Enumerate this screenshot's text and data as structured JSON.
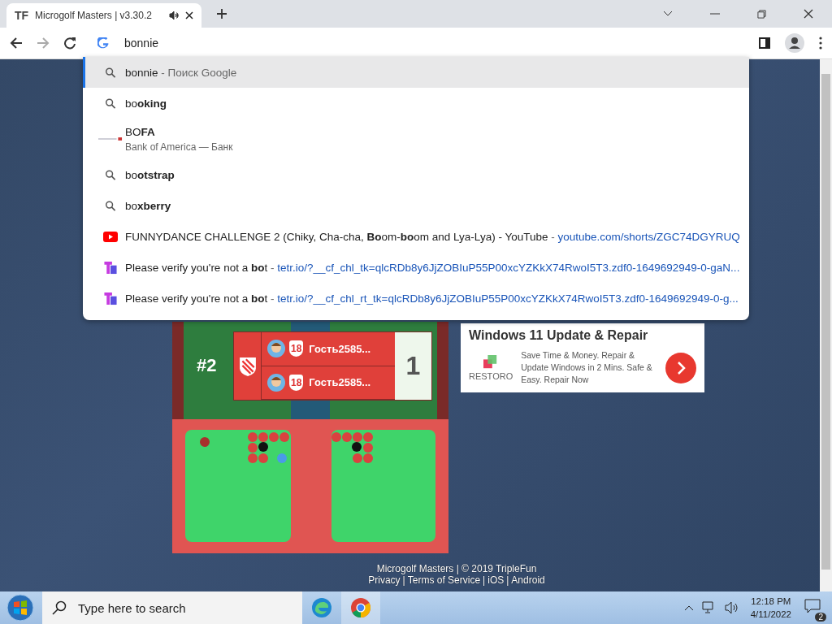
{
  "tab": {
    "favicon": "TF",
    "title": "Microgolf Masters | v3.30.2",
    "audio": true,
    "selected": true
  },
  "omnibox": {
    "value": "bonnie"
  },
  "suggestions": [
    {
      "kind": "search",
      "text": "bonnie",
      "suffix": " - Поиск Google",
      "selected": true
    },
    {
      "kind": "search",
      "text": "bo**oking**",
      "selected": false
    },
    {
      "kind": "site",
      "text": "BO**FA**",
      "subtitle": "Bank of America — Банк",
      "selected": false
    },
    {
      "kind": "search",
      "text": "bo**otstrap**",
      "selected": false
    },
    {
      "kind": "search",
      "text": "bo**xberry**",
      "selected": false
    },
    {
      "kind": "video",
      "text": "FUNNYDANCE CHALLENGE 2 (Chiky, Cha-cha, **Bo**om-**bo**om and Lya-Lya) - YouTube",
      "divider": " - ",
      "url": "youtube.com/shorts/ZGC74DGYRUQ",
      "selected": false
    },
    {
      "kind": "app",
      "text": "Please verify you're not a **bo**t",
      "divider": " - ",
      "url": "tetr.io/?__cf_chl_tk=qlcRDb8y6JjZOBIuP55P00xcYZKkX74RwoI5T3.zdf0-1649692949-0-gaN...",
      "selected": false
    },
    {
      "kind": "app",
      "text": "Please verify you're not a **bo**t",
      "divider": " - ",
      "url": "tetr.io/?__cf_chl_rt_tk=qlcRDb8y6JjZOBIuP55P00xcYZKkX74RwoI5T3.zdf0-1649692949-0-g...",
      "selected": false
    }
  ],
  "game": {
    "rank": "#2",
    "players": [
      {
        "level": "18",
        "name": "Гость2585..."
      },
      {
        "level": "18",
        "name": "Гость2585..."
      }
    ],
    "score": "1"
  },
  "ad": {
    "heading": "Windows 11 Update & Repair",
    "brand": "RESTORO",
    "text": "Save Time & Money. Repair & Update Windows in 2 Mins. Safe & Easy. Repair Now"
  },
  "footer": {
    "line1": "Microgolf Masters | © 2019 TripleFun",
    "separator": "|",
    "links": [
      "Privacy",
      "Terms of Service",
      "iOS",
      "Android"
    ]
  },
  "taskbar": {
    "search_placeholder": "Type here to search",
    "time": "12:18 PM",
    "date": "4/11/2022",
    "notifications": "2"
  }
}
